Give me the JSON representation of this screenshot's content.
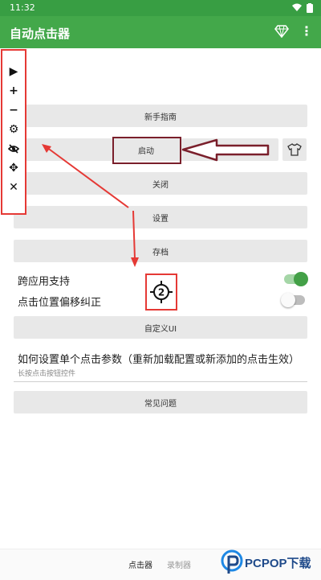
{
  "status_bar": {
    "time": "11:32"
  },
  "app_bar": {
    "title": "自动点击器"
  },
  "floating_panel": {
    "items": [
      {
        "icon": "play-icon",
        "glyph": "▶"
      },
      {
        "icon": "plus-icon",
        "glyph": "+"
      },
      {
        "icon": "minus-icon",
        "glyph": "−"
      },
      {
        "icon": "gear-icon",
        "glyph": "⚙"
      },
      {
        "icon": "eye-off-icon",
        "glyph": ""
      },
      {
        "icon": "move-icon",
        "glyph": "✥"
      },
      {
        "icon": "close-icon",
        "glyph": "✕"
      }
    ]
  },
  "buttons": {
    "guide": "新手指南",
    "start": "启动",
    "close": "关闭",
    "settings": "设置",
    "archive": "存档",
    "custom_ui": "自定义UI",
    "faq": "常见问题"
  },
  "options": {
    "cross_app": {
      "label": "跨应用支持",
      "enabled": true
    },
    "offset_fix": {
      "label": "点击位置偏移纠正",
      "enabled": false
    }
  },
  "target_marker": {
    "number": "2"
  },
  "info": {
    "title": "如何设置单个点击参数（重新加载配置或新添加的点击生效）",
    "subtitle": "长按点击按钮控件"
  },
  "bottom_nav": {
    "tabs": [
      "点击器",
      "录制器"
    ]
  },
  "watermark": {
    "text": "PCPOP下载"
  },
  "colors": {
    "primary": "#43a84a",
    "annotation_red": "#e53935",
    "annotation_dark_red": "#7a1f2b"
  }
}
